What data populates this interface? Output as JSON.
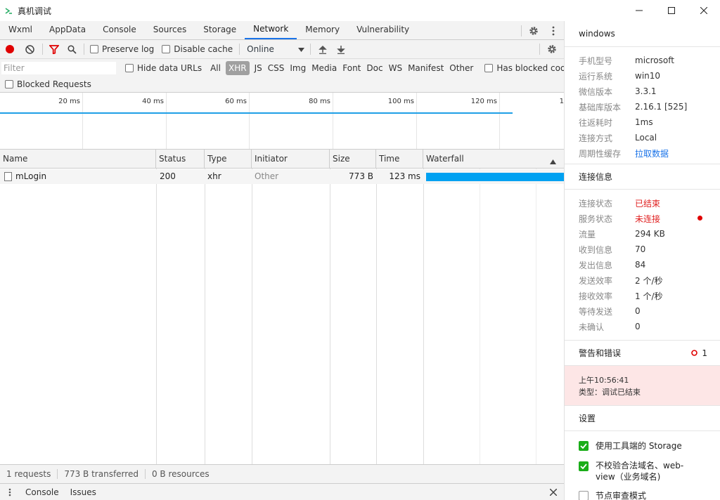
{
  "window": {
    "title": "真机调试"
  },
  "tabs": [
    "Wxml",
    "AppData",
    "Console",
    "Sources",
    "Storage",
    "Network",
    "Memory",
    "Vulnerability"
  ],
  "active_tab": "Network",
  "toolbar": {
    "preserve_log": "Preserve log",
    "disable_cache": "Disable cache",
    "throttle": "Online"
  },
  "filterbar": {
    "placeholder": "Filter",
    "hide_data_urls": "Hide data URLs",
    "types": [
      "All",
      "XHR",
      "JS",
      "CSS",
      "Img",
      "Media",
      "Font",
      "Doc",
      "WS",
      "Manifest",
      "Other"
    ],
    "selected_type": "XHR",
    "has_blocked_cookies": "Has blocked cookies",
    "blocked_requests": "Blocked Requests"
  },
  "overview": {
    "ticks": [
      "20 ms",
      "40 ms",
      "60 ms",
      "80 ms",
      "100 ms",
      "120 ms",
      "1"
    ]
  },
  "table": {
    "headers": {
      "name": "Name",
      "status": "Status",
      "type": "Type",
      "initiator": "Initiator",
      "size": "Size",
      "time": "Time",
      "waterfall": "Waterfall"
    },
    "rows": [
      {
        "name": "mLogin",
        "status": "200",
        "type": "xhr",
        "initiator": "Other",
        "size": "773 B",
        "time": "123 ms"
      }
    ]
  },
  "statusbar": {
    "requests": "1 requests",
    "transferred": "773 B transferred",
    "resources": "0 B resources"
  },
  "drawer": {
    "tabs": [
      "Console",
      "Issues"
    ]
  },
  "panel": {
    "title": "windows",
    "device": [
      {
        "k": "手机型号",
        "v": "microsoft"
      },
      {
        "k": "运行系统",
        "v": "win10"
      },
      {
        "k": "微信版本",
        "v": "3.3.1"
      },
      {
        "k": "基础库版本",
        "v": "2.16.1 [525]"
      },
      {
        "k": "往返耗时",
        "v": "1ms"
      },
      {
        "k": "连接方式",
        "v": "Local"
      },
      {
        "k": "周期性缓存",
        "v": "拉取数据"
      }
    ],
    "conn_title": "连接信息",
    "conn": [
      {
        "k": "连接状态",
        "v": "已结束"
      },
      {
        "k": "服务状态",
        "v": "未连接"
      },
      {
        "k": "流量",
        "v": "294 KB"
      },
      {
        "k": "收到信息",
        "v": "70"
      },
      {
        "k": "发出信息",
        "v": "84"
      },
      {
        "k": "发送效率",
        "v": "2 个/秒"
      },
      {
        "k": "接收效率",
        "v": "1 个/秒"
      },
      {
        "k": "等待发送",
        "v": "0"
      },
      {
        "k": "未确认",
        "v": "0"
      }
    ],
    "warn_title": "警告和错误",
    "warn_count": "1",
    "alert_time": "上午10:56:41",
    "alert_type": "类型：调试已结束",
    "settings_title": "设置",
    "settings": [
      {
        "label": "使用工具端的 Storage",
        "checked": true
      },
      {
        "label": "不校验合法域名、web-view（业务域名)",
        "checked": true
      },
      {
        "label": "节点审查模式",
        "checked": false
      }
    ]
  },
  "colors": {
    "accent": "#1a73e8",
    "record": "#e00000",
    "error": "#e02020",
    "waterfall": "#00a1f1",
    "check": "#1aad19"
  }
}
